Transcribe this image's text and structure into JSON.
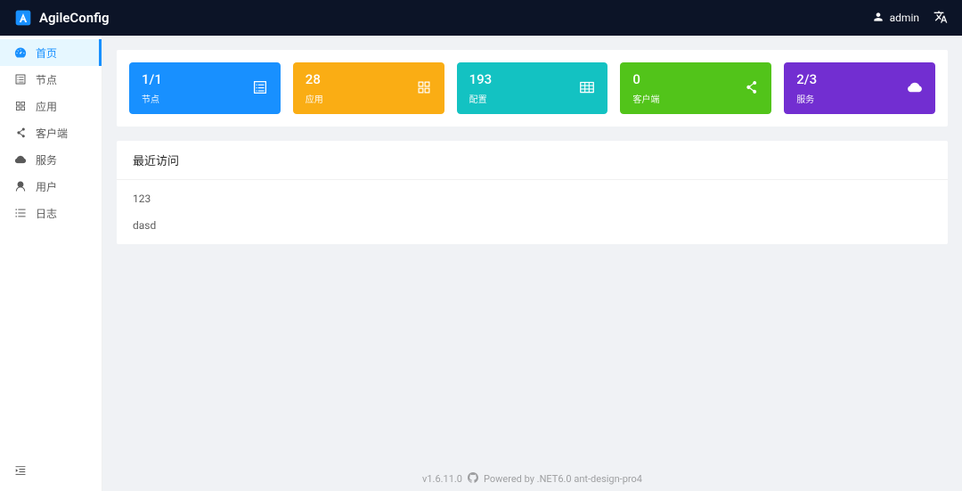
{
  "header": {
    "brand": "AgileConfig",
    "user": "admin"
  },
  "sidebar": {
    "items": [
      {
        "label": "首页",
        "icon": "dashboard",
        "active": true
      },
      {
        "label": "节点",
        "icon": "cluster",
        "active": false
      },
      {
        "label": "应用",
        "icon": "appstore",
        "active": false
      },
      {
        "label": "客户端",
        "icon": "deployment",
        "active": false
      },
      {
        "label": "服务",
        "icon": "cloud",
        "active": false
      },
      {
        "label": "用户",
        "icon": "user",
        "active": false
      },
      {
        "label": "日志",
        "icon": "bars",
        "active": false
      }
    ]
  },
  "stats": [
    {
      "value": "1/1",
      "label": "节点",
      "color": "c-blue",
      "icon": "cluster"
    },
    {
      "value": "28",
      "label": "应用",
      "color": "c-orange",
      "icon": "appstore"
    },
    {
      "value": "193",
      "label": "配置",
      "color": "c-teal",
      "icon": "table"
    },
    {
      "value": "0",
      "label": "客户端",
      "color": "c-green",
      "icon": "deployment"
    },
    {
      "value": "2/3",
      "label": "服务",
      "color": "c-purple",
      "icon": "cloud"
    }
  ],
  "recent": {
    "title": "最近访问",
    "items": [
      "123",
      "dasd"
    ]
  },
  "footer": {
    "version": "v1.6.11.0",
    "powered": "Powered by .NET6.0 ant-design-pro4"
  }
}
